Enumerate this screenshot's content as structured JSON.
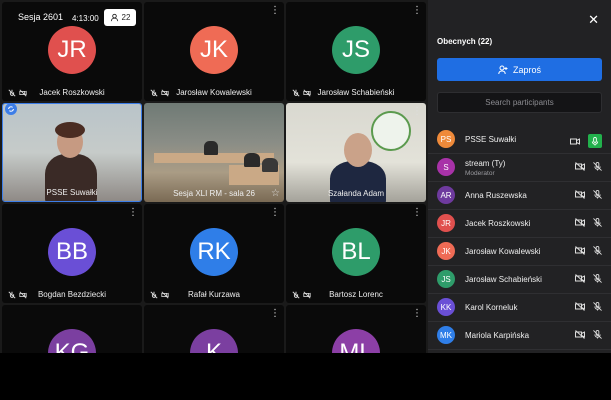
{
  "session": {
    "title": "Sesja 2601",
    "clock": "4:13:00",
    "participant_count": "22"
  },
  "tiles": [
    {
      "initials": "JR",
      "name": "Jacek Roszkowski",
      "color": "#e0504e"
    },
    {
      "initials": "JK",
      "name": "Jarosław Kowalewski",
      "color": "#ef6b55"
    },
    {
      "initials": "JS",
      "name": "Jarosław Schabieński",
      "color": "#2e9c6a"
    },
    {
      "name": "PSSE Suwałki"
    },
    {
      "name": "Sesja XLI RM - sala 26"
    },
    {
      "name": "Szałanda Adam"
    },
    {
      "initials": "BB",
      "name": "Bogdan Bezdziecki",
      "color": "#6a4fd6"
    },
    {
      "initials": "RK",
      "name": "Rafał Kurzawa",
      "color": "#2f7ee8"
    },
    {
      "initials": "BL",
      "name": "Bartosz Lorenc",
      "color": "#2e9c6a"
    },
    {
      "initials": "KG",
      "name": "",
      "color": "#7b3fa0"
    },
    {
      "initials": "K",
      "name": "",
      "color": "#7b3fa0"
    },
    {
      "initials": "ML",
      "name": "",
      "color": "#8c3fa6"
    }
  ],
  "panel": {
    "title": "Obecnych (22)",
    "invite_label": "Zaproś",
    "search_placeholder": "Search participants",
    "participants": [
      {
        "initials": "PS",
        "name": "PSSE Suwałki",
        "color": "#ef8a3a",
        "role": "",
        "camera": "on",
        "mic": "on"
      },
      {
        "initials": "S",
        "name": "stream (Ty)",
        "color": "#a832a8",
        "role": "Moderator",
        "camera": "off",
        "mic": "off"
      },
      {
        "initials": "AR",
        "name": "Anna Ruszewska",
        "color": "#6e3a9e",
        "role": "",
        "camera": "off",
        "mic": "off"
      },
      {
        "initials": "JR",
        "name": "Jacek Roszkowski",
        "color": "#e0504e",
        "role": "",
        "camera": "off",
        "mic": "off"
      },
      {
        "initials": "JK",
        "name": "Jarosław Kowalewski",
        "color": "#ef6b55",
        "role": "",
        "camera": "off",
        "mic": "off"
      },
      {
        "initials": "JS",
        "name": "Jarosław Schabieński",
        "color": "#2e9c6a",
        "role": "",
        "camera": "off",
        "mic": "off"
      },
      {
        "initials": "KK",
        "name": "Karol Korneluk",
        "color": "#6a4fd6",
        "role": "",
        "camera": "off",
        "mic": "off"
      },
      {
        "initials": "MK",
        "name": "Mariola Karpińska",
        "color": "#2f7ee8",
        "role": "",
        "camera": "off",
        "mic": "off"
      }
    ]
  },
  "icons": {
    "close": "close-icon",
    "invite": "add-user-icon",
    "mic_off": "mic-off-icon",
    "camera_off": "camera-off-icon"
  }
}
